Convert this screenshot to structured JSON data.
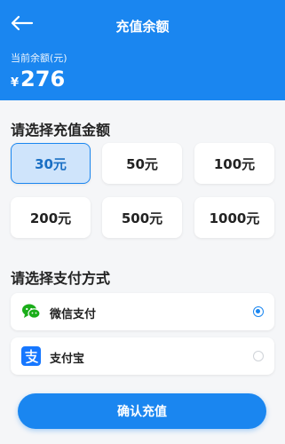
{
  "header": {
    "title": "充值余额",
    "balance_label": "当前余额(元)",
    "currency_symbol": "¥",
    "balance": "276"
  },
  "amount_section": {
    "title": "请选择充值金额",
    "options": [
      {
        "label": "30元",
        "selected": true
      },
      {
        "label": "50元",
        "selected": false
      },
      {
        "label": "100元",
        "selected": false
      },
      {
        "label": "200元",
        "selected": false
      },
      {
        "label": "500元",
        "selected": false
      },
      {
        "label": "1000元",
        "selected": false
      }
    ]
  },
  "payment_section": {
    "title": "请选择支付方式",
    "methods": [
      {
        "label": "微信支付",
        "icon": "wechat-pay-icon",
        "selected": true
      },
      {
        "label": "支付宝",
        "icon": "alipay-icon",
        "selected": false
      }
    ]
  },
  "confirm_label": "确认充值",
  "colors": {
    "primary": "#1a86f0",
    "selected_bg": "#cfe4fb",
    "wechat_green": "#1aad19",
    "alipay_blue": "#1677ff"
  }
}
